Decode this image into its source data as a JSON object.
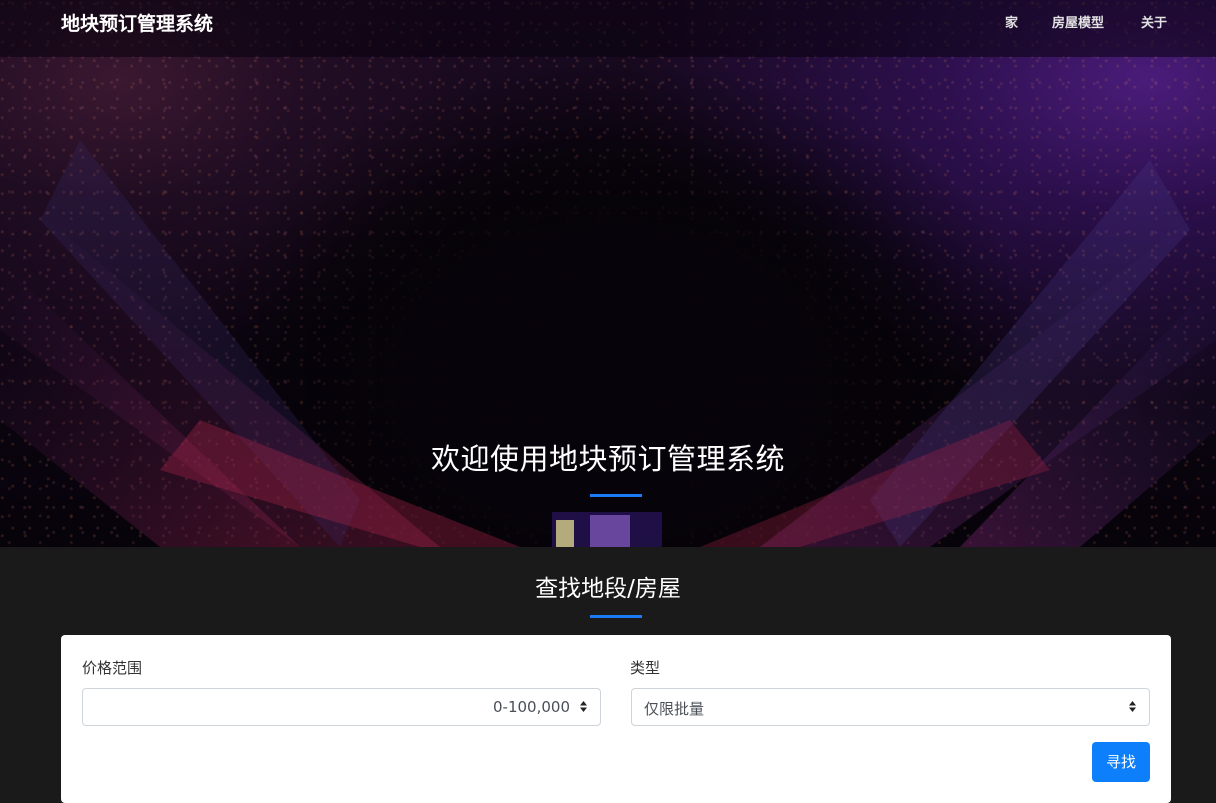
{
  "navbar": {
    "brand": "地块预订管理系统",
    "links": [
      "家",
      "房屋模型",
      "关于"
    ]
  },
  "hero": {
    "title": "欢迎使用地块预订管理系统"
  },
  "search": {
    "title": "查找地段/房屋",
    "price_label": "价格范围",
    "price_value": "0-100,000",
    "type_label": "类型",
    "type_value": "仅限批量",
    "find_button": "寻找"
  },
  "colors": {
    "accent": "#1a7bf5",
    "button": "#0d7ffb",
    "section_bg": "#1a1a1a"
  }
}
